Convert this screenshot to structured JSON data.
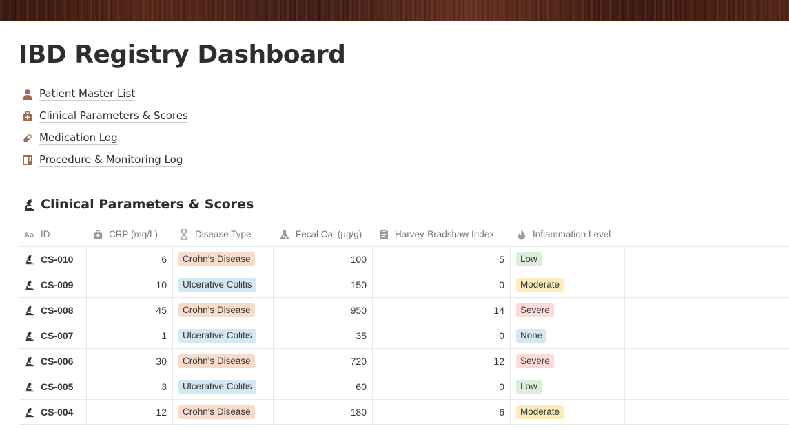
{
  "page": {
    "title": "IBD Registry Dashboard"
  },
  "links": [
    {
      "label": "Patient Master List",
      "icon": "person-icon"
    },
    {
      "label": "Clinical Parameters & Scores",
      "icon": "medkit-icon"
    },
    {
      "label": "Medication Log",
      "icon": "pill-icon"
    },
    {
      "label": "Procedure & Monitoring Log",
      "icon": "layout-icon"
    }
  ],
  "database": {
    "title": "Clinical Parameters & Scores",
    "icon": "microscope-icon",
    "columns": [
      {
        "label": "ID",
        "icon": "text-property-icon"
      },
      {
        "label": "CRP (mg/L)",
        "icon": "medkit-icon"
      },
      {
        "label": "Disease Type",
        "icon": "dna-icon"
      },
      {
        "label": "Fecal Cal (µg/g)",
        "icon": "flask-icon"
      },
      {
        "label": "Harvey-Bradshaw Index",
        "icon": "clipboard-icon"
      },
      {
        "label": "Inflammation Level",
        "icon": "fire-icon"
      }
    ],
    "rows": [
      {
        "id": "CS-010",
        "crp": "6",
        "disease": "Crohn's Disease",
        "fecal": "100",
        "hbi": "5",
        "inflammation": "Low"
      },
      {
        "id": "CS-009",
        "crp": "10",
        "disease": "Ulcerative Colitis",
        "fecal": "150",
        "hbi": "0",
        "inflammation": "Moderate"
      },
      {
        "id": "CS-008",
        "crp": "45",
        "disease": "Crohn's Disease",
        "fecal": "950",
        "hbi": "14",
        "inflammation": "Severe"
      },
      {
        "id": "CS-007",
        "crp": "1",
        "disease": "Ulcerative Colitis",
        "fecal": "35",
        "hbi": "0",
        "inflammation": "None"
      },
      {
        "id": "CS-006",
        "crp": "30",
        "disease": "Crohn's Disease",
        "fecal": "720",
        "hbi": "12",
        "inflammation": "Severe"
      },
      {
        "id": "CS-005",
        "crp": "3",
        "disease": "Ulcerative Colitis",
        "fecal": "60",
        "hbi": "0",
        "inflammation": "Low"
      },
      {
        "id": "CS-004",
        "crp": "12",
        "disease": "Crohn's Disease",
        "fecal": "180",
        "hbi": "6",
        "inflammation": "Moderate"
      }
    ]
  },
  "colors": {
    "icon_brown": "#9f6b53",
    "tag_crohns_bg": "#f8dccb",
    "tag_uc_bg": "#d4e8f4",
    "tag_low_bg": "#dbeddb",
    "tag_moderate_bg": "#fbeabb",
    "tag_severe_bg": "#fbdcd8",
    "tag_none_bg": "#d4e8f4"
  }
}
